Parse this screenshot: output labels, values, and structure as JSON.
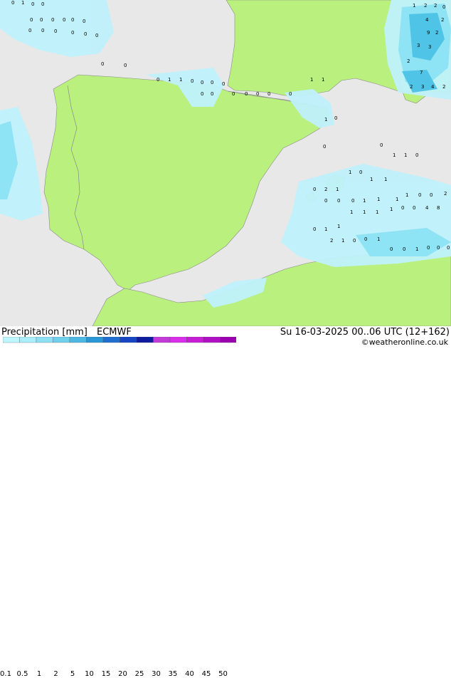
{
  "legend": {
    "title": "Precipitation [mm]",
    "model": "ECMWF",
    "ticks": [
      "0.1",
      "0.5",
      "1",
      "2",
      "5",
      "10",
      "15",
      "20",
      "25",
      "30",
      "35",
      "40",
      "45",
      "50"
    ],
    "colors": [
      "#bdf6fe",
      "#a9eefa",
      "#8de0f4",
      "#6fd0ec",
      "#4eb8e2",
      "#2a98d6",
      "#1f6fd0",
      "#1845c2",
      "#101c9e",
      "#c43ad8",
      "#d82ee8",
      "#c71ed6",
      "#b010c4",
      "#9a00b0"
    ]
  },
  "valid_time": "Su 16-03-2025 00..06 UTC (12+162)",
  "credit": "©weatheronline.co.uk",
  "colors": {
    "land": "#b9f07e",
    "sea": "#e8e8e8",
    "border": "#8a8a8a",
    "precip_light": "#bff1fb",
    "precip_mid": "#8ee3f4",
    "precip_strong": "#4fc4e6"
  },
  "map_labels": [
    "0",
    "1",
    "0",
    "0",
    "0",
    "0",
    "0",
    "0",
    "0",
    "0",
    "0",
    "0",
    "0",
    "0",
    "0",
    "0",
    "1",
    "2",
    "2",
    "0",
    "4",
    "2",
    "9",
    "2",
    "3",
    "3",
    "2",
    "7",
    "2",
    "3",
    "4",
    "2",
    "0",
    "0",
    "0",
    "1",
    "1",
    "0",
    "0",
    "0",
    "0",
    "0",
    "0",
    "0",
    "0",
    "0",
    "0",
    "0",
    "1",
    "1",
    "1",
    "0",
    "0",
    "0",
    "1",
    "1",
    "0",
    "0",
    "2",
    "1",
    "1",
    "0",
    "1",
    "1",
    "0",
    "0",
    "0",
    "1",
    "1",
    "1",
    "1",
    "0",
    "0",
    "2",
    "0",
    "1",
    "1",
    "1",
    "1",
    "1",
    "1",
    "0",
    "0",
    "4",
    "8",
    "2",
    "1",
    "0",
    "0",
    "1",
    "0",
    "0",
    "1",
    "0",
    "0",
    "0"
  ]
}
